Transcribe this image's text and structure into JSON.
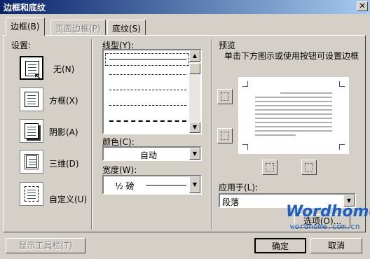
{
  "window": {
    "title": "边框和底纹"
  },
  "tabs": [
    {
      "label": "边框(B)",
      "active": true,
      "disabled": false
    },
    {
      "label": "页面边框(P)",
      "active": false,
      "disabled": true
    },
    {
      "label": "底纹(S)",
      "active": false,
      "disabled": false
    }
  ],
  "settings": {
    "heading": "设置:",
    "items": [
      {
        "label": "无(N)",
        "selected": true
      },
      {
        "label": "方框(X)",
        "selected": false
      },
      {
        "label": "阴影(A)",
        "selected": false
      },
      {
        "label": "三维(D)",
        "selected": false
      },
      {
        "label": "自定义(U)",
        "selected": false
      }
    ]
  },
  "line_style": {
    "heading": "线型(Y):",
    "styles": [
      "solid",
      "dotted",
      "dashed-short",
      "dashed",
      "dash-dot",
      "dash-dot-dot"
    ]
  },
  "color": {
    "label": "颜色(C):",
    "value": "自动"
  },
  "width": {
    "label": "宽度(W):",
    "value": "½ 磅"
  },
  "preview": {
    "heading": "预览",
    "hint": "单击下方图示或使用按钮可设置边框"
  },
  "apply_to": {
    "label": "应用于(L):",
    "value": "段落"
  },
  "options_button": "选项(O)...",
  "toolbar_button": "显示工具栏(T)",
  "ok_button": "确定",
  "cancel_button": "取消",
  "watermark": {
    "brand": "Wordhome",
    "url": "wordhome.com.cn"
  },
  "colors": {
    "title_start": "#0a246a",
    "title_end": "#a6caf0",
    "face": "#d4d0c8",
    "brand": "#1b5fbf"
  }
}
